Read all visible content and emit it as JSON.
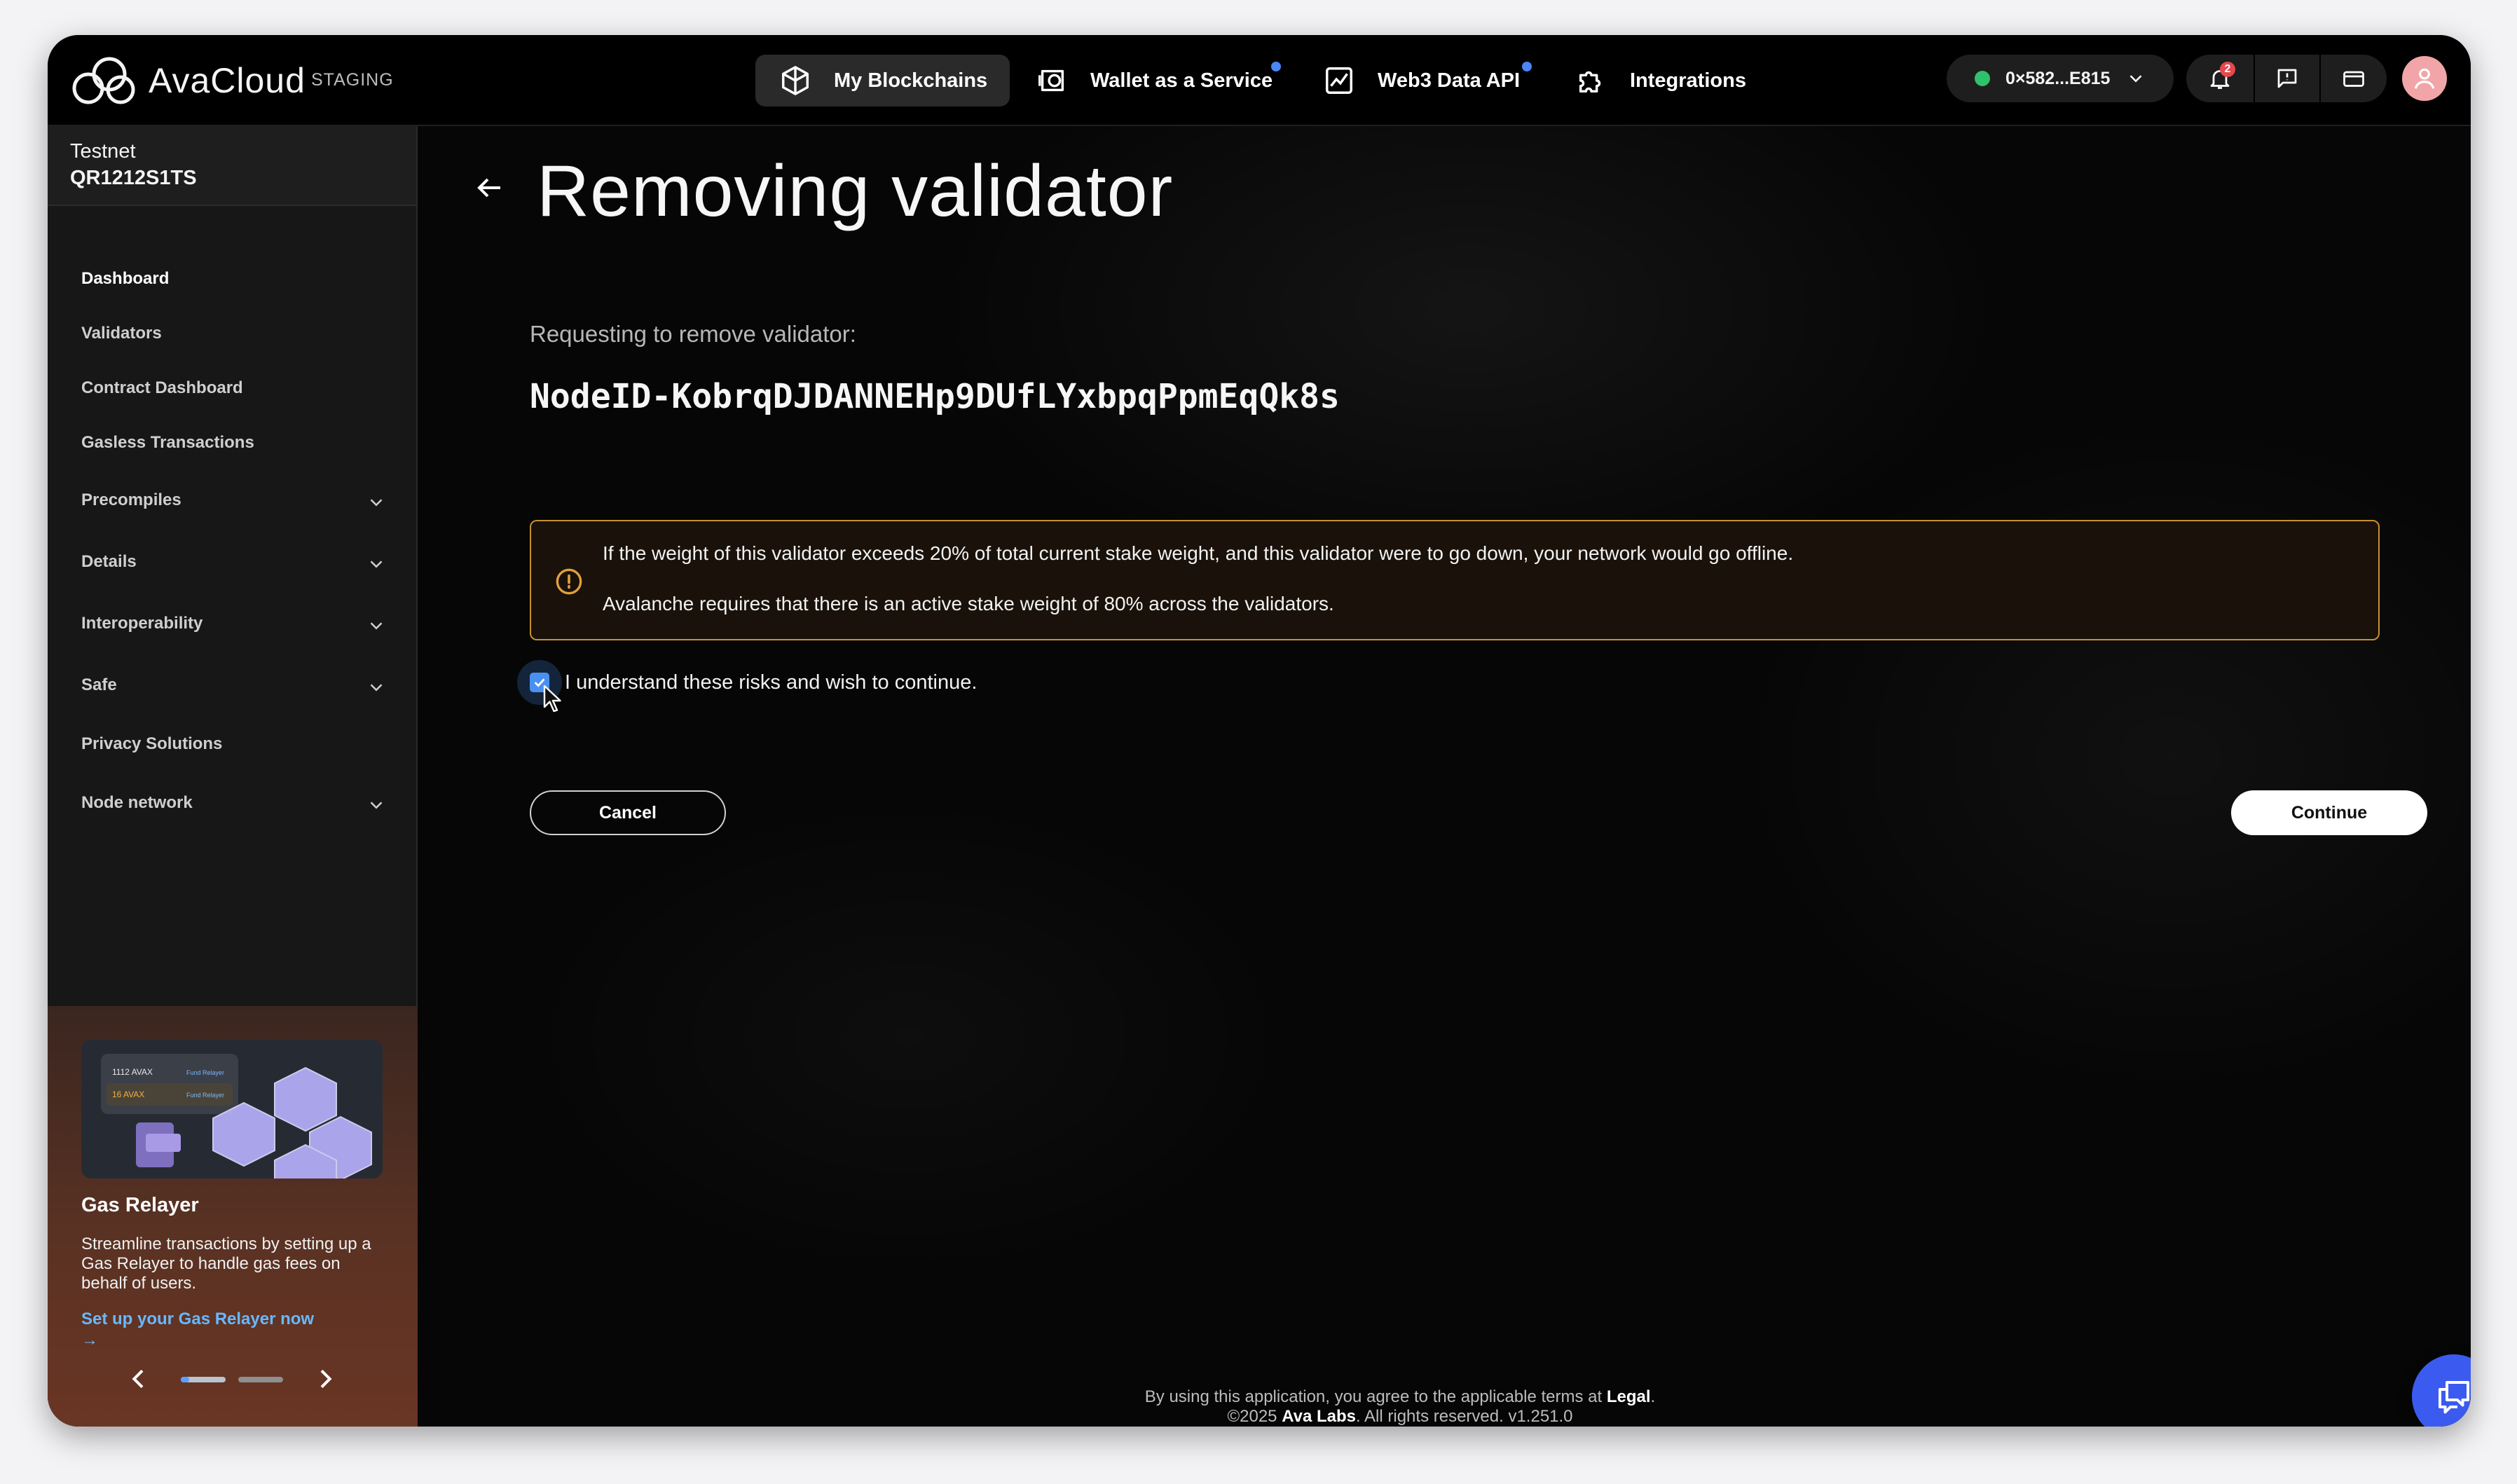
{
  "topbar": {
    "brand": "AvaCloud",
    "env": "STAGING",
    "nav": [
      {
        "label": "My Blockchains",
        "icon": "cube-icon",
        "active": true
      },
      {
        "label": "Wallet as a Service",
        "icon": "wallet-icon",
        "dot": true
      },
      {
        "label": "Web3 Data API",
        "icon": "chart-icon",
        "dot": true
      },
      {
        "label": "Integrations",
        "icon": "puzzle-icon"
      }
    ],
    "wallet_address": "0×582...E815",
    "notification_count": "2"
  },
  "sidebar": {
    "network_label": "Testnet",
    "network_id": "QR1212S1TS",
    "items": [
      {
        "label": "Dashboard"
      },
      {
        "label": "Validators"
      },
      {
        "label": "Contract Dashboard"
      },
      {
        "label": "Gasless Transactions"
      },
      {
        "label": "Precompiles"
      },
      {
        "label": "Details"
      },
      {
        "label": "Interoperability"
      },
      {
        "label": "Safe"
      },
      {
        "label": "Privacy Solutions"
      },
      {
        "label": "Node network"
      }
    ],
    "promo": {
      "img_line1_amount": "1112 AVAX",
      "img_line1_tag": "Fund Relayer",
      "img_line2_amount": "16 AVAX",
      "img_line2_tag": "Fund Relayer",
      "title": "Gas Relayer",
      "description": "Streamline transactions by setting up a Gas Relayer to handle gas fees on behalf of users.",
      "link": "Set up your Gas Relayer now →"
    }
  },
  "main": {
    "title": "Removing validator",
    "request_label": "Requesting to remove validator:",
    "node_id": "NodeID-KobrqDJDANNEHp9DUfLYxbpqPpmEqQk8s",
    "warning_line1": "If the weight of this validator exceeds 20% of total current stake weight, and this validator were to go down, your network would go offline.",
    "warning_line2": "Avalanche requires that there is an active stake weight of 80% across the validators.",
    "checkbox_label": "I understand these risks and wish to continue.",
    "checkbox_checked": true,
    "cancel_label": "Cancel",
    "continue_label": "Continue"
  },
  "footer": {
    "line1_prefix": "By using this application, you agree to the applicable terms at ",
    "line1_link": "Legal",
    "line1_suffix": ".",
    "line2_prefix": "©2025 ",
    "line2_company": "Ava Labs",
    "line2_suffix": ".  All rights reserved.  v1.251.0"
  },
  "colors": {
    "accent_blue": "#4a90f0",
    "warning_border": "#c9902e",
    "status_green": "#2ec26a",
    "chat_button": "#3b5bf0"
  }
}
